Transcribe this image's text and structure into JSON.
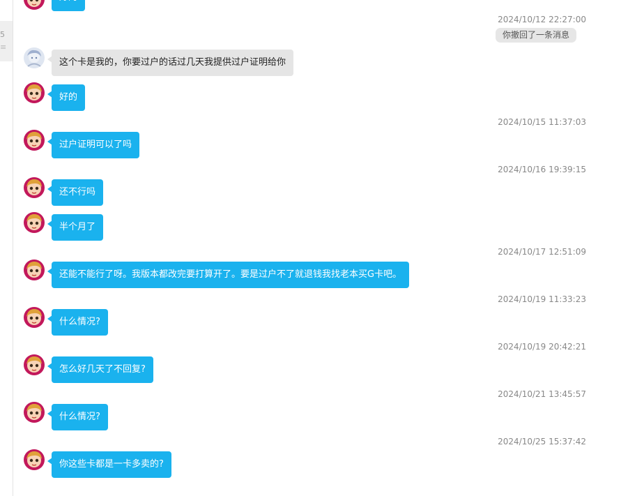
{
  "sidebar": {
    "tab_line1": "5",
    "tab_line2": "≡"
  },
  "recall_notice": "你撤回了一条消息",
  "messages": [
    {
      "text": "好的"
    },
    {
      "timestamp": "2024/10/12 22:27:00"
    },
    {
      "text": "这个卡是我的，你要过户的话过几天我提供过户证明给你"
    },
    {
      "text": "好的"
    },
    {
      "timestamp": "2024/10/15 11:37:03"
    },
    {
      "text": "过户证明可以了吗"
    },
    {
      "timestamp": "2024/10/16 19:39:15"
    },
    {
      "text": "还不行吗"
    },
    {
      "text": "半个月了"
    },
    {
      "timestamp": "2024/10/17 12:51:09"
    },
    {
      "text": "还能不能行了呀。我版本都改完要打算开了。要是过户不了就退钱我找老本买G卡吧。"
    },
    {
      "timestamp": "2024/10/19 11:33:23"
    },
    {
      "text": "什么情况?"
    },
    {
      "timestamp": "2024/10/19 20:42:21"
    },
    {
      "text": "怎么好几天了不回复?"
    },
    {
      "timestamp": "2024/10/21 13:45:57"
    },
    {
      "text": "什么情况?"
    },
    {
      "timestamp": "2024/10/25 15:37:42"
    },
    {
      "text": "你这些卡都是一卡多卖的?"
    }
  ],
  "colors": {
    "my_bubble": "#1ab2ee",
    "other_bubble": "#e5e5e5",
    "timestamp_text": "#888888"
  }
}
